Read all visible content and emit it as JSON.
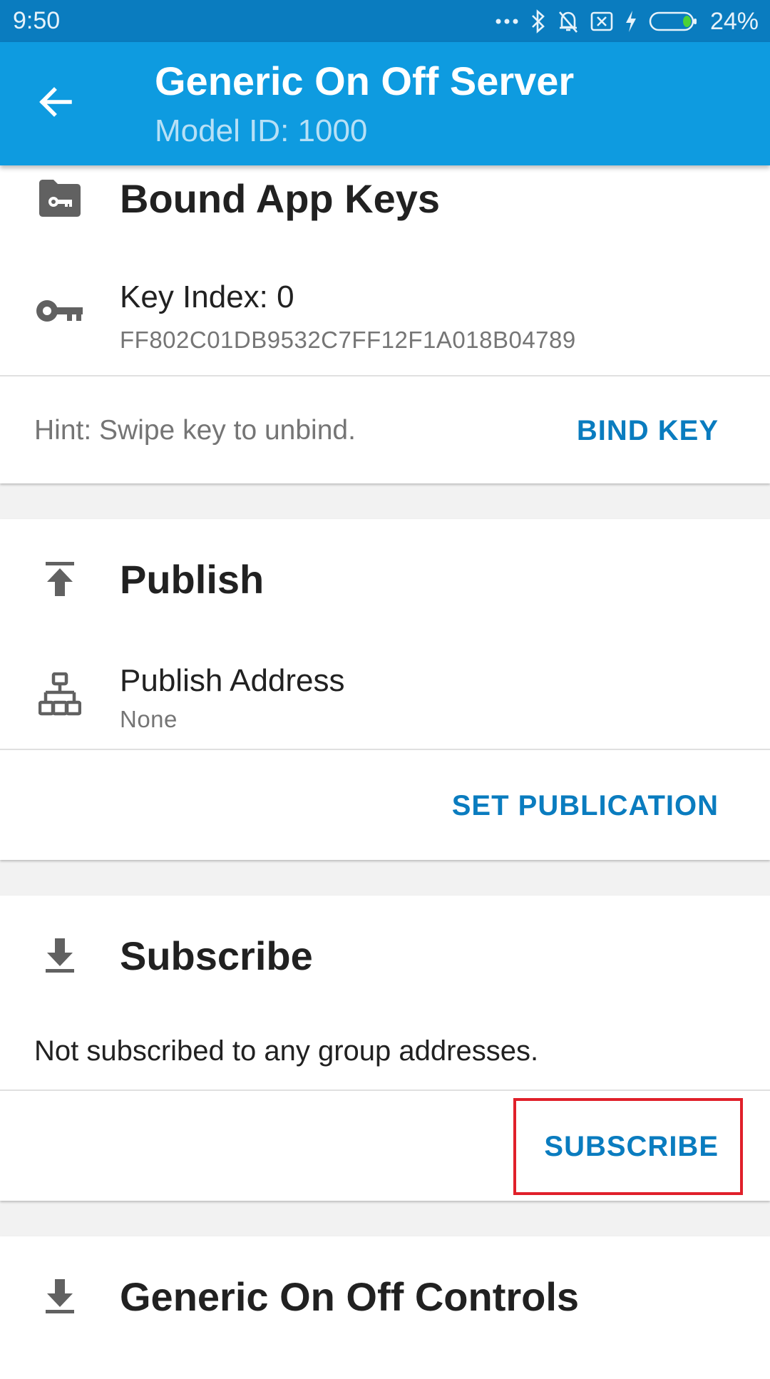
{
  "status_bar": {
    "time": "9:50",
    "battery_percent": "24%",
    "battery_level": 0.24,
    "icons": [
      "more-dots-icon",
      "bluetooth-icon",
      "notifications-off-icon",
      "sim-blocked-icon",
      "charging-icon",
      "battery-icon"
    ]
  },
  "app_bar": {
    "title": "Generic On Off Server",
    "subtitle": "Model ID: 1000",
    "back_icon": "arrow-back-icon"
  },
  "bound_app_keys": {
    "title": "Bound App Keys",
    "header_icon": "folder-key-icon",
    "key": {
      "icon": "key-icon",
      "label": "Key Index: 0",
      "value": "FF802C01DB9532C7FF12F1A018B04789"
    },
    "hint": "Hint: Swipe key to unbind.",
    "action_label": "BIND KEY"
  },
  "publish": {
    "title": "Publish",
    "header_icon": "publish-icon",
    "address": {
      "icon": "network-icon",
      "label": "Publish Address",
      "value": "None"
    },
    "action_label": "SET PUBLICATION"
  },
  "subscribe": {
    "title": "Subscribe",
    "header_icon": "download-icon",
    "message": "Not subscribed to any group addresses.",
    "action_label": "SUBSCRIBE"
  },
  "controls": {
    "title": "Generic On Off Controls",
    "header_icon": "download-icon"
  },
  "colors": {
    "status_bar": "#0a7cbf",
    "app_bar": "#0e9be0",
    "accent": "#0a7cbf",
    "highlight": "#e0202a"
  }
}
